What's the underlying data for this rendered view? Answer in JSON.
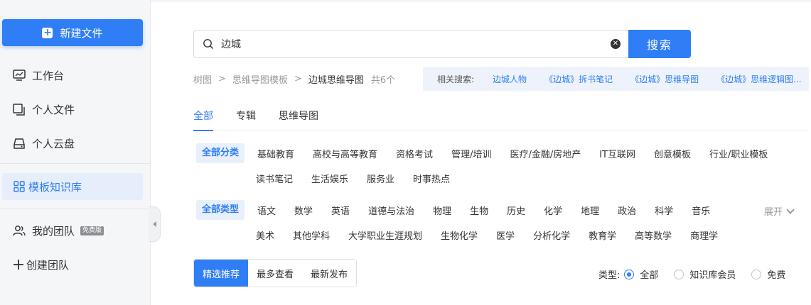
{
  "sidebar": {
    "new_file": "新建文件",
    "items": [
      {
        "label": "工作台"
      },
      {
        "label": "个人文件"
      },
      {
        "label": "个人云盘"
      },
      {
        "label": "模板知识库"
      },
      {
        "label": "我的团队",
        "badge": "免费版"
      },
      {
        "label": "创建团队"
      }
    ]
  },
  "search": {
    "value": "边城",
    "button": "搜索"
  },
  "breadcrumb": {
    "items": [
      "树图",
      "思维导图模板",
      "边城思维导图"
    ],
    "count": "共6个"
  },
  "related": {
    "label": "相关搜索:",
    "tags": [
      "边城人物",
      "《边城》拆书笔记",
      "《边城》思维导图",
      "《边城》思维逻辑图..."
    ]
  },
  "tabs": [
    "全部",
    "专辑",
    "思维导图"
  ],
  "filters": {
    "category_all": "全部分类",
    "categories_row1": [
      "基础教育",
      "高校与高等教育",
      "资格考试",
      "管理/培训",
      "医疗/金融/房地产",
      "IT互联网",
      "创意模板",
      "行业/职业模板"
    ],
    "categories_row2": [
      "读书笔记",
      "生活娱乐",
      "服务业",
      "时事热点"
    ],
    "type_all": "全部类型",
    "types_row1": [
      "语文",
      "数学",
      "英语",
      "道德与法治",
      "物理",
      "生物",
      "历史",
      "化学",
      "地理",
      "政治",
      "科学",
      "音乐"
    ],
    "types_row2": [
      "美术",
      "其他学科",
      "大学职业生涯规划",
      "生物化学",
      "医学",
      "分析化学",
      "教育学",
      "高等数学",
      "商理学"
    ],
    "expand": "展开"
  },
  "sort": [
    "精选推荐",
    "最多查看",
    "最新发布"
  ],
  "type_filter": {
    "label": "类型:",
    "options": [
      "全部",
      "知识库会员",
      "免费"
    ],
    "selected": "全部"
  },
  "colors": {
    "accent": "#2f7ef5",
    "sidebar_bg": "#f5f6f8",
    "related_bg": "#eef3fb"
  }
}
